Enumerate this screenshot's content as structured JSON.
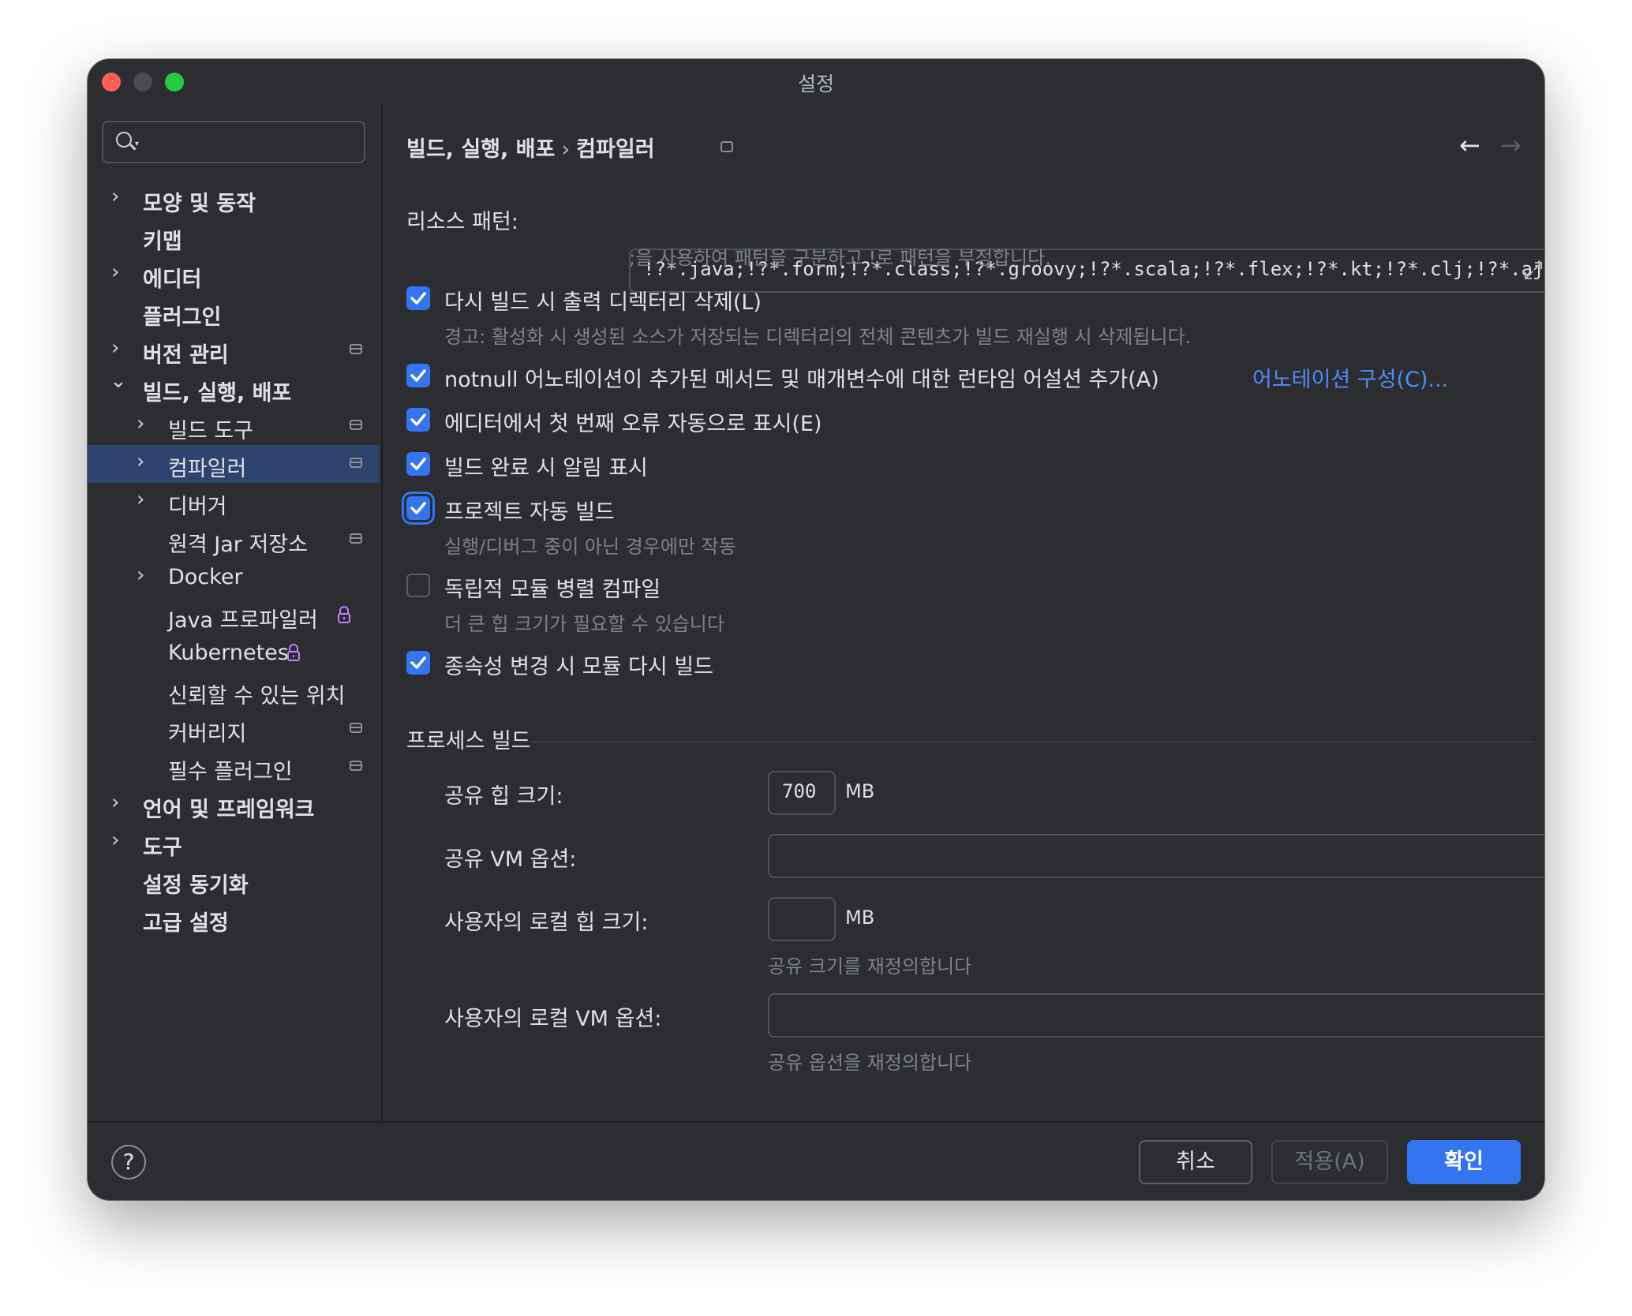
{
  "window": {
    "title": "설정"
  },
  "sidebar": {
    "items": [
      {
        "label": "모양 및 동작",
        "bold": true,
        "chevron": "›"
      },
      {
        "label": "키맵",
        "bold": true,
        "chevron": ""
      },
      {
        "label": "에디터",
        "bold": true,
        "chevron": "›"
      },
      {
        "label": "플러그인",
        "bold": true,
        "chevron": ""
      },
      {
        "label": "버전 관리",
        "bold": true,
        "chevron": "›"
      },
      {
        "label": "빌드, 실행, 배포",
        "bold": true,
        "chevron": "⌄"
      },
      {
        "label": "빌드 도구",
        "bold": false,
        "chevron": "›"
      },
      {
        "label": "컴파일러",
        "bold": false,
        "chevron": "›"
      },
      {
        "label": "디버거",
        "bold": false,
        "chevron": "›"
      },
      {
        "label": "원격 Jar 저장소",
        "bold": false,
        "chevron": ""
      },
      {
        "label": "Docker",
        "bold": false,
        "chevron": "›"
      },
      {
        "label": "Java 프로파일러",
        "bold": false,
        "chevron": ""
      },
      {
        "label": "Kubernetes",
        "bold": false,
        "chevron": ""
      },
      {
        "label": "신뢰할 수 있는 위치",
        "bold": false,
        "chevron": ""
      },
      {
        "label": "커버리지",
        "bold": false,
        "chevron": ""
      },
      {
        "label": "필수 플러그인",
        "bold": false,
        "chevron": ""
      },
      {
        "label": "언어 및 프레임워크",
        "bold": true,
        "chevron": "›"
      },
      {
        "label": "도구",
        "bold": true,
        "chevron": "›"
      },
      {
        "label": "설정 동기화",
        "bold": true,
        "chevron": ""
      },
      {
        "label": "고급 설정",
        "bold": true,
        "chevron": ""
      }
    ],
    "selected": "컴파일러"
  },
  "breadcrumb": {
    "parent": "빌드, 실행, 배포",
    "separator": "›",
    "current": "컴파일러"
  },
  "resource": {
    "label": "리소스 패턴:",
    "value": "!?*.java;!?*.form;!?*.class;!?*.groovy;!?*.scala;!?*.flex;!?*.kt;!?*.clj;!?*.aj",
    "hint": ";을 사용하여 패턴을 구분하고 !로 패턴을 부정합니다."
  },
  "options": {
    "clear_output": {
      "label": "다시 빌드 시 출력 디렉터리 삭제(L)",
      "checked": true,
      "hint": "경고: 활성화 시 생성된 소스가 저장되는 디렉터리의 전체 콘텐츠가 빌드 재실행 시 삭제됩니다."
    },
    "notnull": {
      "label": "notnull 어노테이션이 추가된 메서드 및 매개변수에 대한 런타임 어설션 추가(A)",
      "checked": true,
      "link": "어노테이션 구성(C)..."
    },
    "show_first_error": {
      "label": "에디터에서 첫 번째 오류 자동으로 표시(E)",
      "checked": true
    },
    "notify_build": {
      "label": "빌드 완료 시 알림 표시",
      "checked": true
    },
    "auto_build": {
      "label": "프로젝트 자동 빌드",
      "checked": true,
      "hint": "실행/디버그 중이 아닌 경우에만 작동"
    },
    "parallel": {
      "label": "독립적 모듈 병렬 컴파일",
      "checked": false,
      "hint": "더 큰 힙 크기가 필요할 수 있습니다"
    },
    "rebuild_deps": {
      "label": "종속성 변경 시 모듈 다시 빌드",
      "checked": true
    }
  },
  "process": {
    "section_title": "프로세스 빌드",
    "shared_heap_label": "공유 힙 크기:",
    "shared_heap_value": "700",
    "unit": "MB",
    "shared_vm_label": "공유 VM 옵션:",
    "shared_vm_value": "",
    "user_heap_label": "사용자의 로컬 힙 크기:",
    "user_heap_value": "",
    "user_heap_hint": "공유 크기를 재정의합니다",
    "user_vm_label": "사용자의 로컬 VM 옵션:",
    "user_vm_value": "",
    "user_vm_hint": "공유 옵션을 재정의합니다"
  },
  "footer": {
    "help": "?",
    "cancel": "취소",
    "apply": "적용(A)",
    "ok": "확인"
  },
  "colors": {
    "accent": "#3574f0",
    "link": "#548af7",
    "background": "#2b2d30",
    "lock": "#c77dff"
  },
  "icons": {
    "search": "search-icon",
    "back": "arrow-left-icon",
    "forward": "arrow-right-icon",
    "expand": "expand-icon",
    "lock": "lock-icon"
  }
}
